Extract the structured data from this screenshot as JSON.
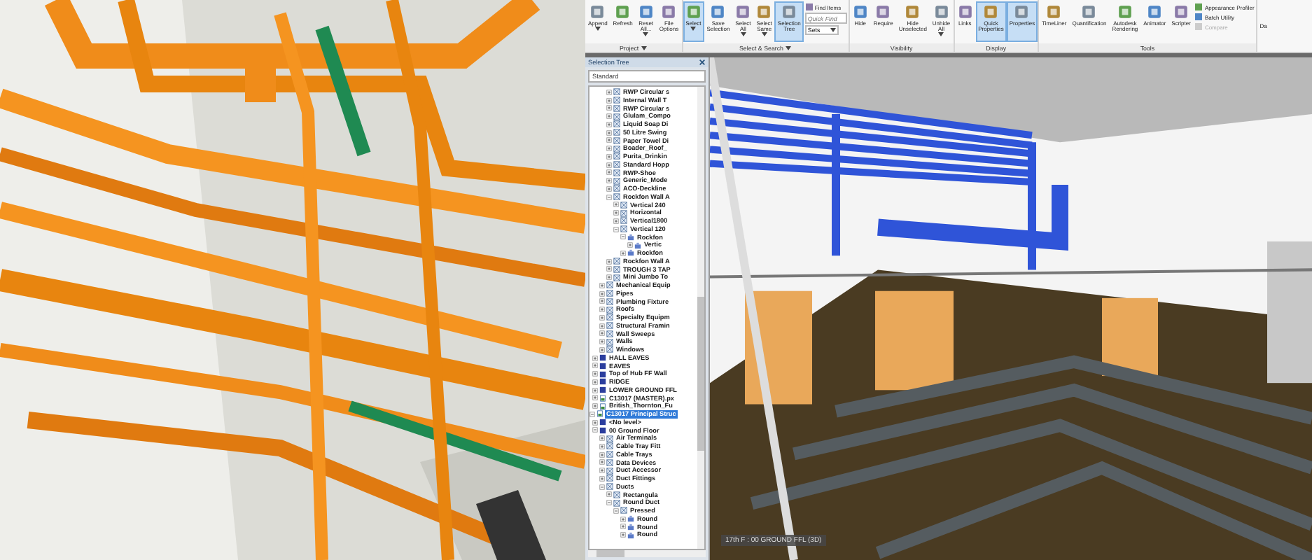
{
  "ribbon": {
    "groups": [
      {
        "label": "Project",
        "has_menu": true,
        "buttons": [
          {
            "label": "Append",
            "selected": false,
            "has_menu": true
          },
          {
            "label": "Refresh",
            "selected": false,
            "has_menu": false
          },
          {
            "label": "Reset All...",
            "selected": false,
            "has_menu": true
          },
          {
            "label": "File Options",
            "selected": false,
            "has_menu": false
          }
        ]
      },
      {
        "label": "Select & Search",
        "has_menu": true,
        "buttons": [
          {
            "label": "Select",
            "selected": true,
            "has_menu": true
          },
          {
            "label": "Save Selection",
            "selected": false,
            "has_menu": false
          },
          {
            "label": "Select All",
            "selected": false,
            "has_menu": true
          },
          {
            "label": "Select Same",
            "selected": false,
            "has_menu": true
          },
          {
            "label": "Selection Tree",
            "selected": true,
            "has_menu": false
          }
        ],
        "stack": [
          {
            "kind": "button",
            "label": "Find Items",
            "disabled": false
          },
          {
            "kind": "search",
            "placeholder": "Quick Find"
          },
          {
            "kind": "dropdown",
            "label": "Sets"
          }
        ]
      },
      {
        "label": "Visibility",
        "has_menu": false,
        "buttons": [
          {
            "label": "Hide",
            "selected": false,
            "has_menu": false
          },
          {
            "label": "Require",
            "selected": false,
            "has_menu": false
          },
          {
            "label": "Hide Unselected",
            "selected": false,
            "has_menu": false
          },
          {
            "label": "Unhide All",
            "selected": false,
            "has_menu": true
          }
        ]
      },
      {
        "label": "Display",
        "has_menu": false,
        "buttons": [
          {
            "label": "Links",
            "selected": false,
            "has_menu": false
          },
          {
            "label": "Quick Properties",
            "selected": true,
            "has_menu": false
          },
          {
            "label": "Properties",
            "selected": true,
            "has_menu": false
          }
        ]
      },
      {
        "label": "Tools",
        "has_menu": false,
        "buttons": [
          {
            "label": "TimeLiner",
            "selected": false,
            "has_menu": false
          },
          {
            "label": "Quantification",
            "selected": false,
            "has_menu": false
          },
          {
            "label": "Autodesk Rendering",
            "selected": false,
            "has_menu": false
          },
          {
            "label": "Animator",
            "selected": false,
            "has_menu": false
          },
          {
            "label": "Scripter",
            "selected": false,
            "has_menu": false
          }
        ],
        "stack": [
          {
            "kind": "button",
            "label": "Appearance Profiler",
            "disabled": false
          },
          {
            "kind": "button",
            "label": "Batch Utility",
            "disabled": false
          },
          {
            "kind": "button",
            "label": "Compare",
            "disabled": true
          }
        ]
      }
    ],
    "cut_button": "Da"
  },
  "selection_tree": {
    "title": "Selection Tree",
    "mode": "Standard",
    "items": [
      {
        "children": [
          {
            "children": [
              {
                "children": [
                  {
                    "label": "RWP Circular s",
                    "kind": "group",
                    "expanded": false,
                    "selected": false
                  },
                  {
                    "label": "Internal Wall T",
                    "kind": "group",
                    "expanded": false,
                    "selected": false
                  },
                  {
                    "label": "RWP Circular s",
                    "kind": "group",
                    "expanded": false,
                    "selected": false
                  },
                  {
                    "label": "Glulam_Compo",
                    "kind": "group",
                    "expanded": false,
                    "selected": false
                  },
                  {
                    "label": "Liquid Soap Di",
                    "kind": "group",
                    "expanded": false,
                    "selected": false
                  },
                  {
                    "label": "50 Litre Swing",
                    "kind": "group",
                    "expanded": false,
                    "selected": false
                  },
                  {
                    "label": "Paper Towel Di",
                    "kind": "group",
                    "expanded": false,
                    "selected": false
                  },
                  {
                    "label": "Boader_Roof_",
                    "kind": "group",
                    "expanded": false,
                    "selected": false
                  },
                  {
                    "label": "Purita_Drinkin",
                    "kind": "group",
                    "expanded": false,
                    "selected": false
                  },
                  {
                    "label": "Standard Hopp",
                    "kind": "group",
                    "expanded": false,
                    "selected": false
                  },
                  {
                    "label": "RWP-Shoe",
                    "kind": "group",
                    "expanded": false,
                    "selected": false
                  },
                  {
                    "label": "Generic_Mode",
                    "kind": "group",
                    "expanded": false,
                    "selected": false
                  },
                  {
                    "label": "ACO-Deckline",
                    "kind": "group",
                    "expanded": false,
                    "selected": false
                  },
                  {
                    "label": "Rockfon Wall A",
                    "kind": "group",
                    "expanded": true,
                    "selected": false,
                    "children": [
                      {
                        "label": "Vertical 240",
                        "kind": "group",
                        "expanded": false,
                        "selected": false
                      },
                      {
                        "label": "Horizontal",
                        "kind": "group",
                        "expanded": false,
                        "selected": false
                      },
                      {
                        "label": "Vertical1800",
                        "kind": "group",
                        "expanded": false,
                        "selected": false
                      },
                      {
                        "label": "Vertical 120",
                        "kind": "group",
                        "expanded": true,
                        "selected": false,
                        "children": [
                          {
                            "label": "Rockfon",
                            "kind": "geometry",
                            "expanded": true,
                            "selected": false,
                            "children": [
                              {
                                "label": "Vertic",
                                "kind": "geometry",
                                "expanded": false,
                                "selected": false
                              }
                            ]
                          },
                          {
                            "label": "Rockfon",
                            "kind": "geometry",
                            "expanded": false,
                            "selected": false
                          }
                        ]
                      }
                    ]
                  },
                  {
                    "label": "Rockfon Wall A",
                    "kind": "group",
                    "expanded": false,
                    "selected": false
                  },
                  {
                    "label": "TROUGH 3 TAP",
                    "kind": "group",
                    "expanded": false,
                    "selected": false
                  },
                  {
                    "label": "Mini Jumbo To",
                    "kind": "group",
                    "expanded": false,
                    "selected": false
                  }
                ]
              },
              {
                "label": "Mechanical Equip",
                "kind": "group",
                "expanded": false,
                "selected": false
              },
              {
                "label": "Pipes",
                "kind": "group",
                "expanded": false,
                "selected": false
              },
              {
                "label": "Plumbing Fixture",
                "kind": "group",
                "expanded": false,
                "selected": false
              },
              {
                "label": "Roofs",
                "kind": "group",
                "expanded": false,
                "selected": false
              },
              {
                "label": "Specialty Equipm",
                "kind": "group",
                "expanded": false,
                "selected": false
              },
              {
                "label": "Structural Framin",
                "kind": "group",
                "expanded": false,
                "selected": false
              },
              {
                "label": "Wall Sweeps",
                "kind": "group",
                "expanded": false,
                "selected": false
              },
              {
                "label": "Walls",
                "kind": "group",
                "expanded": false,
                "selected": false
              },
              {
                "label": "Windows",
                "kind": "group",
                "expanded": false,
                "selected": false
              }
            ]
          },
          {
            "label": "HALL EAVES",
            "kind": "layer",
            "expanded": false,
            "selected": false
          },
          {
            "label": "EAVES",
            "kind": "layer",
            "expanded": false,
            "selected": false
          },
          {
            "label": "Top of Hub FF Wall",
            "kind": "layer",
            "expanded": false,
            "selected": false
          },
          {
            "label": "RIDGE",
            "kind": "layer",
            "expanded": false,
            "selected": false
          },
          {
            "label": "LOWER GROUND FFL",
            "kind": "layer",
            "expanded": false,
            "selected": false
          },
          {
            "label": "C13017 (MASTER).px",
            "kind": "file",
            "expanded": false,
            "selected": false
          },
          {
            "label": "British_Thornton_Fu",
            "kind": "file",
            "expanded": false,
            "selected": false
          }
        ]
      },
      {
        "label": "C13017 Principal Struc",
        "kind": "file",
        "expanded": true,
        "selected": true,
        "children": [
          {
            "label": "<No level>",
            "kind": "layer",
            "expanded": false,
            "selected": false
          },
          {
            "label": "00 Ground Floor",
            "kind": "layer",
            "expanded": true,
            "selected": false,
            "children": [
              {
                "label": "Air Terminals",
                "kind": "group",
                "expanded": false,
                "selected": false
              },
              {
                "label": "Cable Tray Fitt",
                "kind": "group",
                "expanded": false,
                "selected": false
              },
              {
                "label": "Cable Trays",
                "kind": "group",
                "expanded": false,
                "selected": false
              },
              {
                "label": "Data Devices",
                "kind": "group",
                "expanded": false,
                "selected": false
              },
              {
                "label": "Duct Accessor",
                "kind": "group",
                "expanded": false,
                "selected": false
              },
              {
                "label": "Duct Fittings",
                "kind": "group",
                "expanded": false,
                "selected": false
              },
              {
                "label": "Ducts",
                "kind": "group",
                "expanded": true,
                "selected": false,
                "children": [
                  {
                    "label": "Rectangula",
                    "kind": "group",
                    "expanded": false,
                    "selected": false
                  },
                  {
                    "label": "Round Duct",
                    "kind": "group",
                    "expanded": true,
                    "selected": false,
                    "children": [
                      {
                        "label": "Pressed",
                        "kind": "group",
                        "expanded": true,
                        "selected": false,
                        "children": [
                          {
                            "label": "Round",
                            "kind": "geometry",
                            "expanded": false,
                            "selected": false
                          },
                          {
                            "label": "Round",
                            "kind": "geometry",
                            "expanded": false,
                            "selected": false
                          },
                          {
                            "label": "Round",
                            "kind": "geometry",
                            "expanded": false,
                            "selected": false
                          }
                        ]
                      }
                    ]
                  }
                ]
              }
            ]
          }
        ]
      }
    ]
  },
  "viewport": {
    "view_label": "17th F : 00 GROUND FFL (3D)"
  }
}
